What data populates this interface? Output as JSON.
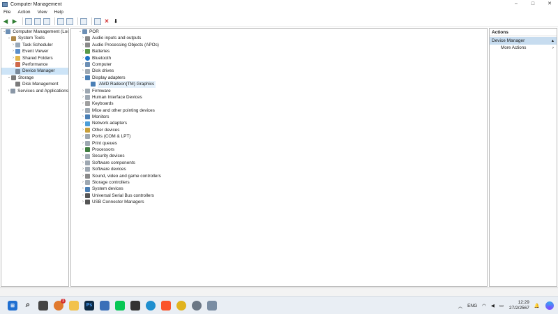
{
  "window": {
    "title": "Computer Management",
    "controls": {
      "minimize": "–",
      "maximize": "□",
      "close": "✕"
    }
  },
  "menu": [
    "File",
    "Action",
    "View",
    "Help"
  ],
  "toolbar_icons": [
    "back-icon",
    "forward-icon",
    "up-folder-icon",
    "show-hide-tree-icon",
    "properties-icon",
    "help-icon",
    "view-icon",
    "scan-hardware-icon",
    "update-driver-icon",
    "uninstall-icon",
    "download-icon"
  ],
  "left_tree": {
    "root": "Computer Management (Local)",
    "system_tools": {
      "label": "System Tools",
      "items": [
        "Task Scheduler",
        "Event Viewer",
        "Shared Folders",
        "Performance",
        "Device Manager"
      ]
    },
    "storage": {
      "label": "Storage",
      "items": [
        "Disk Management"
      ]
    },
    "services": "Services and Applications"
  },
  "device_tree": {
    "root": "POR",
    "categories": [
      "Audio inputs and outputs",
      "Audio Processing Objects (APOs)",
      "Batteries",
      "Bluetooth",
      "Computer",
      "Disk drives",
      "Display adapters",
      "Firmware",
      "Human Interface Devices",
      "Keyboards",
      "Mice and other pointing devices",
      "Monitors",
      "Network adapters",
      "Other devices",
      "Ports (COM & LPT)",
      "Print queues",
      "Processors",
      "Security devices",
      "Software components",
      "Software devices",
      "Sound, video and game controllers",
      "Storage controllers",
      "System devices",
      "Universal Serial Bus controllers",
      "USB Connector Managers"
    ],
    "display_child": "AMD Radeon(TM) Graphics"
  },
  "actions": {
    "header": "Actions",
    "section": "Device Manager",
    "items": [
      "More Actions"
    ]
  },
  "taskbar": {
    "chat_badge": "1",
    "ps_label": "Ps",
    "language": "ENG",
    "time": "12:29",
    "date": "27/2/2567"
  }
}
